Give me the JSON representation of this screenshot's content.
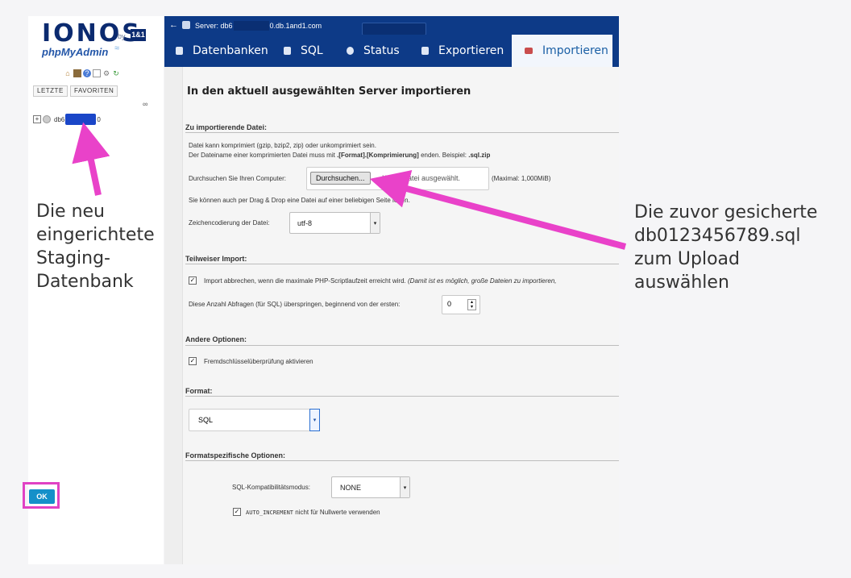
{
  "sidebar": {
    "logo_text": "IONOS",
    "logo_by": "by",
    "logo_brand": "1&1",
    "logo_product": "phpMyAdmin",
    "recent_label": "LETZTE",
    "favorites_label": "FAVORITEN",
    "db_prefix": "db6",
    "db_suffix": "0"
  },
  "topbar": {
    "server_prefix": "Server: db6",
    "server_suffix": "0.db.1and1.com"
  },
  "tabs": [
    {
      "label": "Datenbanken",
      "icon": "database-icon"
    },
    {
      "label": "SQL",
      "icon": "sql-icon"
    },
    {
      "label": "Status",
      "icon": "status-icon"
    },
    {
      "label": "Exportieren",
      "icon": "export-icon"
    },
    {
      "label": "Importieren",
      "icon": "import-icon",
      "active": true
    }
  ],
  "main": {
    "heading": "In den aktuell ausgewählten Server importieren",
    "file_section": {
      "legend": "Zu importierende Datei:",
      "line1": "Datei kann komprimiert (gzip, bzip2, zip) oder unkomprimiert sein.",
      "line2_a": "Der Dateiname einer komprimierten Datei muss mit ",
      "line2_b": ".[Format].[Komprimierung]",
      "line2_c": " enden. Beispiel: ",
      "line2_d": ".sql.zip",
      "browse_label": "Durchsuchen Sie Ihren Computer:",
      "browse_button": "Durchsuchen...",
      "no_file": "Keine Datei ausgewählt.",
      "max_size": "(Maximal: 1,000MiB)",
      "drag_drop": "Sie können auch per Drag & Drop eine Datei auf einer beliebigen Seite legen.",
      "charset_label": "Zeichencodierung der Datei:",
      "charset_value": "utf-8"
    },
    "partial_section": {
      "legend": "Teilweiser Import:",
      "abort_label": "Import abbrechen, wenn die maximale PHP-Scriptlaufzeit erreicht wird.",
      "abort_note": "(Damit ist es möglich, große Dateien zu importieren,",
      "skip_label": "Diese Anzahl Abfragen (für SQL) überspringen, beginnend von der ersten:",
      "skip_value": "0"
    },
    "other_section": {
      "legend": "Andere Optionen:",
      "fk_label": "Fremdschlüsselüberprüfung aktivieren"
    },
    "format_section": {
      "legend": "Format:",
      "value": "SQL"
    },
    "format_options": {
      "legend": "Formatspezifische Optionen:",
      "compat_label": "SQL-Kompatibilitätsmodus:",
      "compat_value": "NONE",
      "auto_inc_code": "AUTO_INCREMENT",
      "auto_inc_label": " nicht für Nullwerte verwenden"
    },
    "ok_label": "OK"
  },
  "annotations": {
    "left": [
      "Die neu",
      "eingerichtete",
      "Staging-",
      "Datenbank"
    ],
    "right": [
      "Die zuvor gesicherte",
      "db0123456789.sql",
      "zum Upload",
      "auswählen"
    ]
  },
  "colors": {
    "nav_blue": "#0d3a87",
    "active_tab_text": "#1a5fa5",
    "ok_blue": "#1590c9",
    "highlight_pink": "#e042c4",
    "redaction_blue": "#1a46c8"
  }
}
